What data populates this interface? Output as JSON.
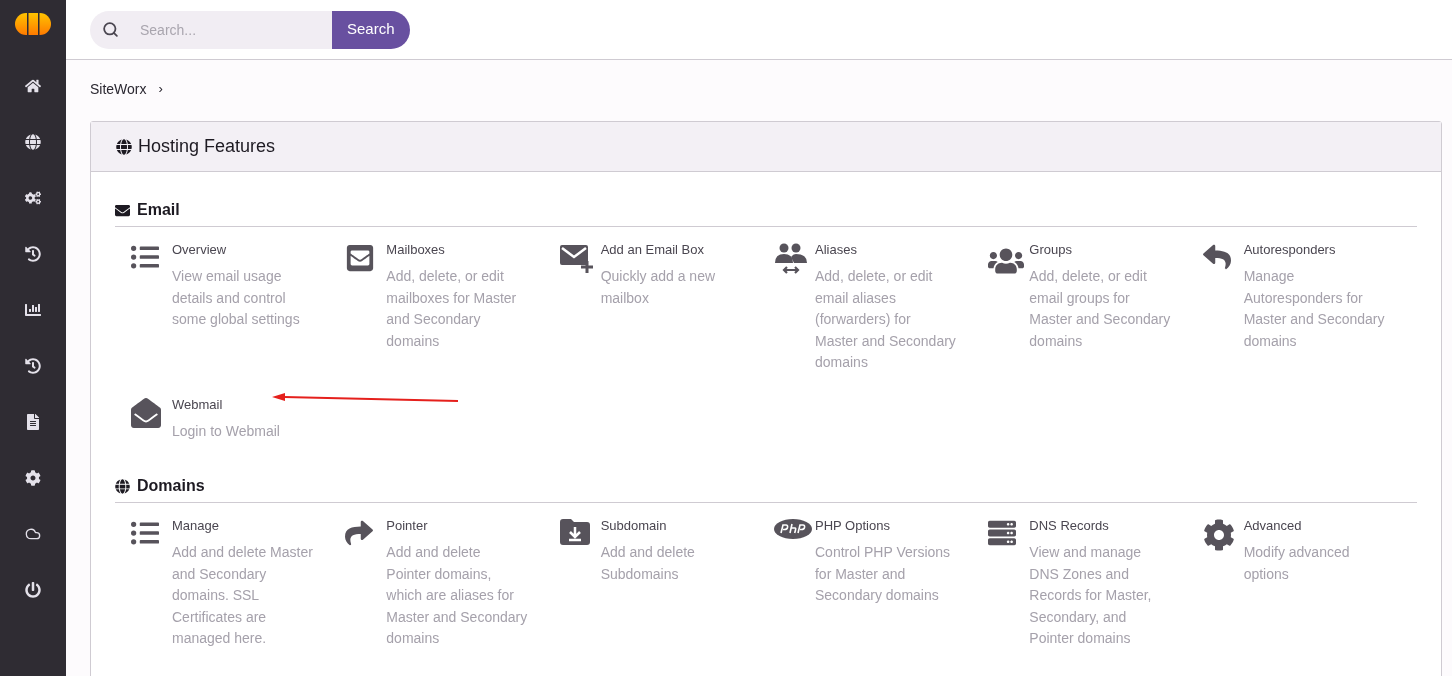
{
  "search": {
    "placeholder": "Search...",
    "button": "Search"
  },
  "breadcrumb": {
    "items": [
      "SiteWorx"
    ],
    "separator": "›"
  },
  "card": {
    "title": "Hosting Features",
    "sections": [
      {
        "title": "Email",
        "items": [
          {
            "title": "Overview",
            "description": "View email usage details and control some global settings"
          },
          {
            "title": "Mailboxes",
            "description": "Add, delete, or edit mailboxes for Master and Secondary domains"
          },
          {
            "title": "Add an Email Box",
            "description": "Quickly add a new mailbox"
          },
          {
            "title": "Aliases",
            "description": "Add, delete, or edit email aliases (forwarders) for Master and Secondary domains"
          },
          {
            "title": "Groups",
            "description": "Add, delete, or edit email groups for Master and Secondary domains"
          },
          {
            "title": "Autoresponders",
            "description": "Manage Autoresponders for Master and Secondary domains"
          },
          {
            "title": "Webmail",
            "description": "Login to Webmail"
          }
        ]
      },
      {
        "title": "Domains",
        "items": [
          {
            "title": "Manage",
            "description": "Add and delete Master and Secondary domains. SSL Certificates are managed here."
          },
          {
            "title": "Pointer",
            "description": "Add and delete Pointer domains, which are aliases for Master and Secondary domains"
          },
          {
            "title": "Subdomain",
            "description": "Add and delete Subdomains"
          },
          {
            "title": "PHP Options",
            "description": "Control PHP Versions for Master and Secondary domains"
          },
          {
            "title": "DNS Records",
            "description": "View and manage DNS Zones and Records for Master, Secondary, and Pointer domains"
          },
          {
            "title": "Advanced",
            "description": "Modify advanced options"
          }
        ]
      }
    ]
  }
}
